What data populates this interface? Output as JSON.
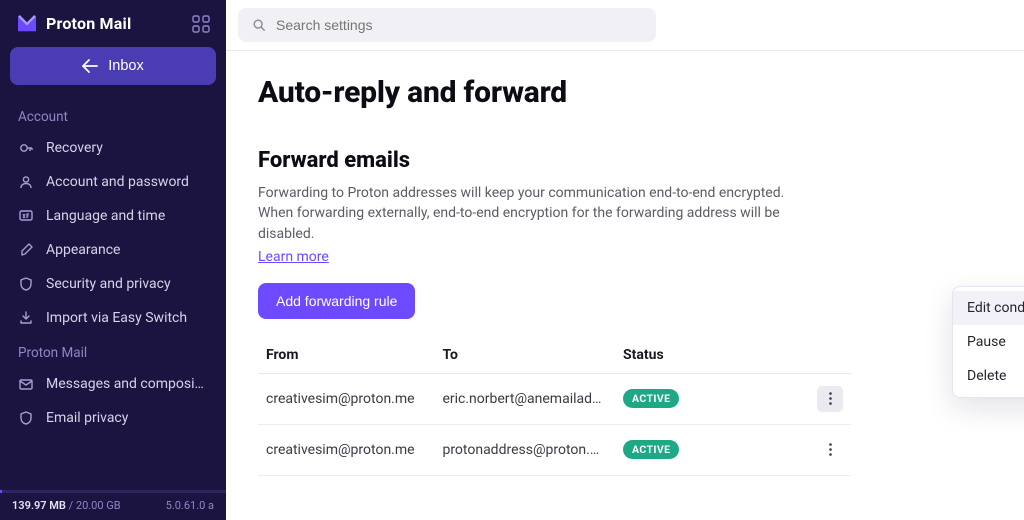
{
  "app": {
    "name": "Proton Mail"
  },
  "inbox_button": {
    "label": "Inbox"
  },
  "sidebar": {
    "sections": [
      {
        "label": "Account",
        "items": [
          {
            "icon": "recovery-icon",
            "label": "Recovery"
          },
          {
            "icon": "user-icon",
            "label": "Account and password"
          },
          {
            "icon": "language-icon",
            "label": "Language and time"
          },
          {
            "icon": "appearance-icon",
            "label": "Appearance"
          },
          {
            "icon": "shield-icon",
            "label": "Security and privacy"
          },
          {
            "icon": "import-icon",
            "label": "Import via Easy Switch"
          }
        ]
      },
      {
        "label": "Proton Mail",
        "items": [
          {
            "icon": "envelope-icon",
            "label": "Messages and composi…"
          },
          {
            "icon": "shield-icon",
            "label": "Email privacy"
          }
        ]
      }
    ],
    "storage": {
      "used": "139.97 MB",
      "total": "20.00 GB",
      "percent": 1
    },
    "version": "5.0.61.0 a"
  },
  "search": {
    "placeholder": "Search settings"
  },
  "page": {
    "title": "Auto-reply and forward",
    "forward": {
      "heading": "Forward emails",
      "description": "Forwarding to Proton addresses will keep your communication end-to-end encrypted. When forwarding externally, end-to-end encryption for the forwarding address will be disabled.",
      "learn_more": "Learn more",
      "add_button": "Add forwarding rule",
      "columns": {
        "from": "From",
        "to": "To",
        "status": "Status"
      },
      "rows": [
        {
          "from": "creativesim@proton.me",
          "to": "eric.norbert@anemailad…",
          "status": "ACTIVE"
        },
        {
          "from": "creativesim@proton.me",
          "to": "protonaddress@proton.…",
          "status": "ACTIVE"
        }
      ]
    }
  },
  "menu": {
    "items": [
      {
        "label": "Edit conditions"
      },
      {
        "label": "Pause"
      },
      {
        "label": "Delete"
      }
    ]
  },
  "colors": {
    "accent": "#6d4aff",
    "sidebar_bg": "#1b1440",
    "badge": "#1ea885"
  }
}
